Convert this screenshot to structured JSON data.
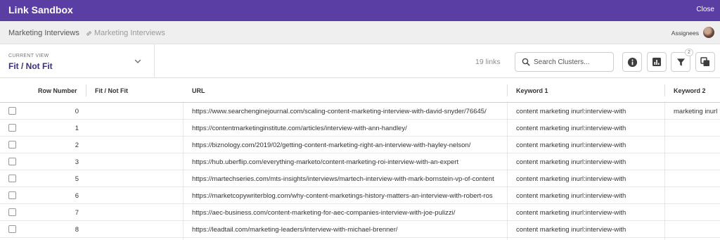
{
  "app": {
    "title": "Link Sandbox",
    "close_label": "Close"
  },
  "breadcrumbs": {
    "current": "Marketing Interviews",
    "linked": "Marketing Interviews",
    "assignees_label": "Assignees"
  },
  "view": {
    "label": "CURRENT VIEW",
    "value": "Fit / Not Fit"
  },
  "toolbar": {
    "link_count": "19 links",
    "search_placeholder": "Search Clusters...",
    "filter_badge": "2"
  },
  "icons": {
    "search": "search-icon",
    "info": "info-icon",
    "chart": "bar-chart-icon",
    "filter": "filter-icon",
    "copy": "copy-icon",
    "link": "link-icon",
    "chevron": "chevron-down-icon"
  },
  "colors": {
    "header_bar": "#5b3ea4",
    "view_value": "#3a2f7a",
    "icon_dark": "#3d3d3d"
  },
  "table": {
    "columns": [
      "Row Number",
      "Fit / Not Fit",
      "URL",
      "Keyword 1",
      "Keyword 2"
    ],
    "rows": [
      {
        "num": "0",
        "url": "https://www.searchenginejournal.com/scaling-content-marketing-interview-with-david-snyder/76645/",
        "kw1": "content marketing inurl:interview-with",
        "kw2": "marketing inurl"
      },
      {
        "num": "1",
        "url": "https://contentmarketinginstitute.com/articles/interview-with-ann-handley/",
        "kw1": "content marketing inurl:interview-with",
        "kw2": ""
      },
      {
        "num": "2",
        "url": "https://biznology.com/2019/02/getting-content-marketing-right-an-interview-with-hayley-nelson/",
        "kw1": "content marketing inurl:interview-with",
        "kw2": ""
      },
      {
        "num": "3",
        "url": "https://hub.uberflip.com/everything-marketo/content-marketing-roi-interview-with-an-expert",
        "kw1": "content marketing inurl:interview-with",
        "kw2": ""
      },
      {
        "num": "5",
        "url": "https://martechseries.com/mts-insights/interviews/martech-interview-with-mark-bornstein-vp-of-content",
        "kw1": "content marketing inurl:interview-with",
        "kw2": ""
      },
      {
        "num": "6",
        "url": "https://marketcopywriterblog.com/why-content-marketings-history-matters-an-interview-with-robert-ros",
        "kw1": "content marketing inurl:interview-with",
        "kw2": ""
      },
      {
        "num": "7",
        "url": "https://aec-business.com/content-marketing-for-aec-companies-interview-with-joe-pulizzi/",
        "kw1": "content marketing inurl:interview-with",
        "kw2": ""
      },
      {
        "num": "8",
        "url": "https://leadtail.com/marketing-leaders/interview-with-michael-brenner/",
        "kw1": "content marketing inurl:interview-with",
        "kw2": ""
      }
    ]
  }
}
